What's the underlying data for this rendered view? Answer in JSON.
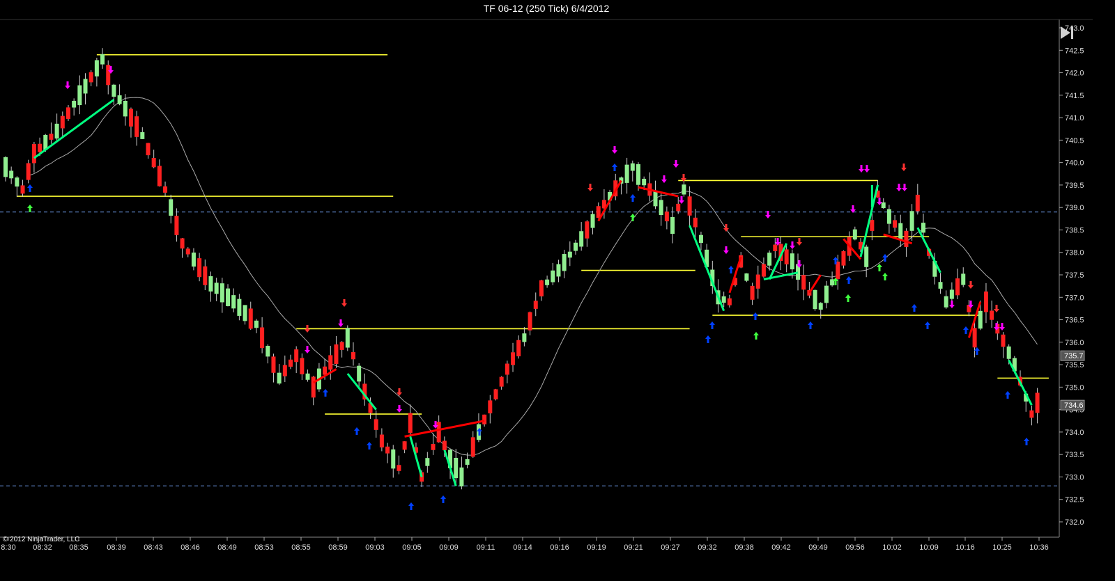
{
  "title": "TF 06-12 (250 Tick)  6/4/2012",
  "copyright": "© 2012 NinjaTrader, LLC",
  "colors": {
    "background": "#000000",
    "up": "#90ee90",
    "down": "#ff2020",
    "yellow": "#ffff33",
    "dashed": "#5b7fbf",
    "sma": "#aaaaaa",
    "trend_up": "#00ff80",
    "trend_down": "#ff0000",
    "arrow_magenta": "#ff00ff",
    "arrow_red": "#ff3030",
    "arrow_blue": "#0040ff",
    "arrow_green": "#40ff40"
  },
  "buttons": {
    "scroll_end_icon": "skip-to-end-icon"
  },
  "chart_data": {
    "type": "candlestick",
    "ylim": [
      731.8,
      743.1
    ],
    "y_ticks": [
      "743.0",
      "742.5",
      "742.0",
      "741.5",
      "741.0",
      "740.5",
      "740.0",
      "739.5",
      "739.0",
      "738.5",
      "738.0",
      "737.5",
      "737.0",
      "736.5",
      "736.0",
      "735.5",
      "735.0",
      "734.5",
      "734.0",
      "733.5",
      "733.0",
      "732.5",
      "732.0"
    ],
    "x_ticks": [
      "8:30",
      "08:32",
      "08:35",
      "08:39",
      "08:43",
      "08:46",
      "08:49",
      "08:53",
      "08:55",
      "08:59",
      "09:03",
      "09:05",
      "09:09",
      "09:11",
      "09:14",
      "09:16",
      "09:19",
      "09:21",
      "09:27",
      "09:32",
      "09:38",
      "09:42",
      "09:49",
      "09:56",
      "10:02",
      "10:09",
      "10:16",
      "10:25",
      "10:36"
    ],
    "bar_count": 182,
    "price_labels": [
      "735.7",
      "734.6"
    ],
    "price_label_values": [
      735.7,
      734.6
    ],
    "dashed_levels": [
      738.9,
      732.8
    ],
    "support_resistance": [
      {
        "from": 16,
        "to": 67,
        "value": 742.4
      },
      {
        "from": 2,
        "to": 68,
        "value": 739.25
      },
      {
        "from": 51,
        "to": 120,
        "value": 736.3
      },
      {
        "from": 56,
        "to": 73,
        "value": 734.4
      },
      {
        "from": 101,
        "to": 121,
        "value": 737.6
      },
      {
        "from": 118,
        "to": 153,
        "value": 739.6
      },
      {
        "from": 129,
        "to": 162,
        "value": 738.35
      },
      {
        "from": 124,
        "to": 171,
        "value": 736.6
      },
      {
        "from": 174,
        "to": 183,
        "value": 735.2
      }
    ],
    "trend_lines": [
      {
        "x1": 5,
        "y1": 740.1,
        "x2": 19,
        "y2": 741.4,
        "dir": "up"
      },
      {
        "x1": 54,
        "y1": 735.1,
        "x2": 58,
        "y2": 735.4,
        "dir": "down"
      },
      {
        "x1": 60,
        "y1": 735.3,
        "x2": 65,
        "y2": 734.5,
        "dir": "up"
      },
      {
        "x1": 70,
        "y1": 733.9,
        "x2": 84,
        "y2": 734.25,
        "dir": "down"
      },
      {
        "x1": 71,
        "y1": 733.9,
        "x2": 73,
        "y2": 733.0,
        "dir": "up"
      },
      {
        "x1": 77,
        "y1": 733.6,
        "x2": 79,
        "y2": 732.8,
        "dir": "up"
      },
      {
        "x1": 104,
        "y1": 738.7,
        "x2": 108,
        "y2": 739.6,
        "dir": "down"
      },
      {
        "x1": 111,
        "y1": 739.45,
        "x2": 118,
        "y2": 739.25,
        "dir": "down"
      },
      {
        "x1": 120,
        "y1": 738.6,
        "x2": 126,
        "y2": 736.7,
        "dir": "up"
      },
      {
        "x1": 127,
        "y1": 737.1,
        "x2": 129,
        "y2": 737.9,
        "dir": "down"
      },
      {
        "x1": 133,
        "y1": 737.4,
        "x2": 139,
        "y2": 737.55,
        "dir": "up"
      },
      {
        "x1": 134,
        "y1": 737.4,
        "x2": 137,
        "y2": 738.2,
        "dir": "up"
      },
      {
        "x1": 141,
        "y1": 737.1,
        "x2": 143,
        "y2": 737.5,
        "dir": "down"
      },
      {
        "x1": 147,
        "y1": 738.3,
        "x2": 150,
        "y2": 737.85,
        "dir": "down"
      },
      {
        "x1": 150,
        "y1": 737.9,
        "x2": 153,
        "y2": 739.5,
        "dir": "up"
      },
      {
        "x1": 152,
        "y1": 739.0,
        "x2": 152,
        "y2": 739.5,
        "dir": "up"
      },
      {
        "x1": 154,
        "y1": 738.4,
        "x2": 159,
        "y2": 738.2,
        "dir": "down"
      },
      {
        "x1": 160,
        "y1": 738.55,
        "x2": 164,
        "y2": 737.55,
        "dir": "up"
      },
      {
        "x1": 169,
        "y1": 736.1,
        "x2": 171,
        "y2": 736.9,
        "dir": "down"
      },
      {
        "x1": 176,
        "y1": 735.6,
        "x2": 180,
        "y2": 734.6,
        "dir": "up"
      }
    ]
  }
}
